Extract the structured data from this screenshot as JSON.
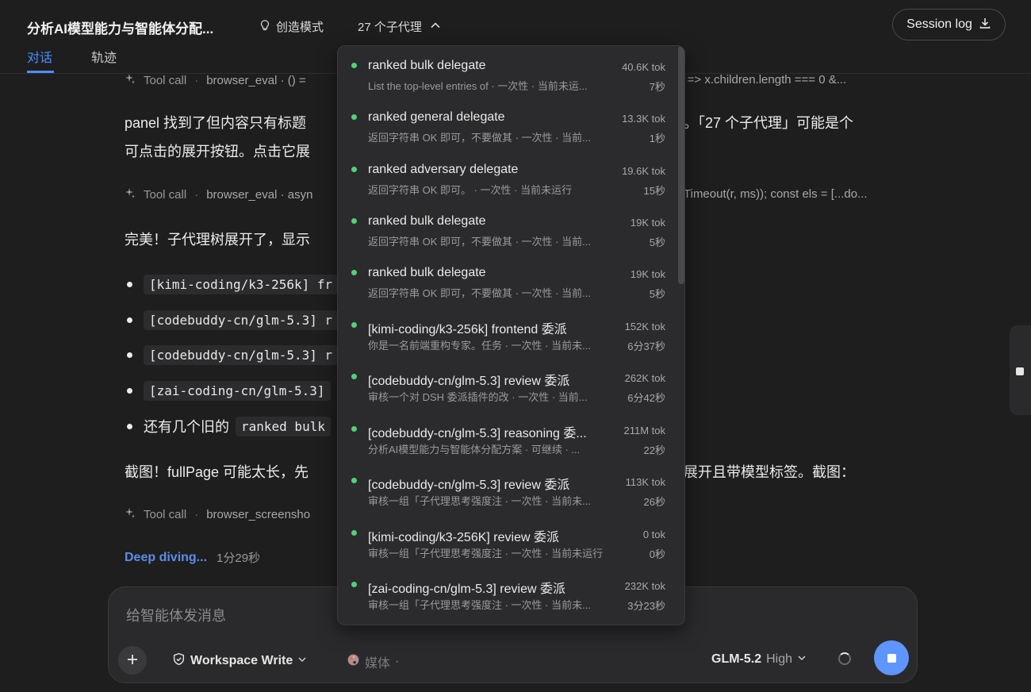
{
  "header": {
    "title": "分析AI模型能力与智能体分配...",
    "mode_label": "创造模式",
    "agents_toggle_label": "27 个子代理",
    "session_log_label": "Session log",
    "tabs": [
      {
        "label": "对话",
        "active": true
      },
      {
        "label": "轨迹",
        "active": false
      }
    ]
  },
  "conversation": {
    "tool_calls": [
      {
        "label": "Tool call",
        "tool": "browser_eval · () =",
        "tail": "x => x.children.length === 0 &..."
      },
      {
        "label": "Tool call",
        "tool": "browser_eval · asyn",
        "tail": "Timeout(r, ms)); const els = [...do..."
      },
      {
        "label": "Tool call",
        "tool": "browser_screensho",
        "tail": ""
      }
    ],
    "para1_line1_left": "panel 找到了但内容只有标题",
    "para1_line1_right": "。「27 个子代理」可能是个",
    "para1_line2": "可点击的展开按钮。点击它展",
    "para2": "完美！子代理树展开了，显示",
    "bullets": [
      {
        "code": "[kimi-coding/k3-256k] fr",
        "text": ""
      },
      {
        "code": "[codebuddy-cn/glm-5.3] r",
        "text": ""
      },
      {
        "code": "[codebuddy-cn/glm-5.3] r",
        "text": ""
      },
      {
        "code": "[zai-coding-cn/glm-5.3]",
        "text": ""
      },
      {
        "prefix": "还有几个旧的",
        "code": "ranked bulk",
        "text": ""
      }
    ],
    "para3_left": "截图！fullPage 可能太长，先",
    "para3_right": "展开且带模型标签。截图：",
    "deep_diving": "Deep diving...",
    "deep_time": "1分29秒"
  },
  "composer": {
    "placeholder": "给智能体发消息",
    "workspace": "Workspace Write",
    "media": "媒体",
    "media_suffix": "·",
    "model_name": "GLM-5.2",
    "model_effort": "High"
  },
  "agents": [
    {
      "name": "ranked bulk delegate",
      "desc": "List the top-level entries of · 一次性 · 当前未运...",
      "tokens": "40.6K tok",
      "duration": "7秒"
    },
    {
      "name": "ranked general delegate",
      "desc": "返回字符串 OK 即可，不要做其 · 一次性 · 当前...",
      "tokens": "13.3K tok",
      "duration": "1秒"
    },
    {
      "name": "ranked adversary delegate",
      "desc": "返回字符串 OK 即可。 · 一次性 · 当前未运行",
      "tokens": "19.6K tok",
      "duration": "15秒"
    },
    {
      "name": "ranked bulk delegate",
      "desc": "返回字符串 OK 即可，不要做其 · 一次性 · 当前...",
      "tokens": "19K tok",
      "duration": "5秒"
    },
    {
      "name": "ranked bulk delegate",
      "desc": "返回字符串 OK 即可，不要做其 · 一次性 · 当前...",
      "tokens": "19K tok",
      "duration": "5秒"
    },
    {
      "name": "[kimi-coding/k3-256k] frontend 委派",
      "desc": "你是一名前端重构专家。任务 · 一次性 · 当前未...",
      "tokens": "152K tok",
      "duration": "6分37秒"
    },
    {
      "name": "[codebuddy-cn/glm-5.3] review 委派",
      "desc": "审核一个对 DSH 委派插件的改 · 一次性 · 当前...",
      "tokens": "262K tok",
      "duration": "6分42秒"
    },
    {
      "name": "[codebuddy-cn/glm-5.3] reasoning 委...",
      "desc": "分析AI模型能力与智能体分配方案 · 可继续 · ...",
      "tokens": "211M tok",
      "duration": "22秒"
    },
    {
      "name": "[codebuddy-cn/glm-5.3] review 委派",
      "desc": "审核一组「子代理思考强度注 · 一次性 · 当前未...",
      "tokens": "113K tok",
      "duration": "26秒"
    },
    {
      "name": "[kimi-coding/k3-256K] review 委派",
      "desc": "审核一组「子代理思考强度注 · 一次性 · 当前未运行",
      "tokens": "0 tok",
      "duration": "0秒"
    },
    {
      "name": "[zai-coding-cn/glm-5.3] review 委派",
      "desc": "审核一组「子代理思考强度注 · 一次性 · 当前未...",
      "tokens": "232K tok",
      "duration": "3分23秒"
    }
  ]
}
